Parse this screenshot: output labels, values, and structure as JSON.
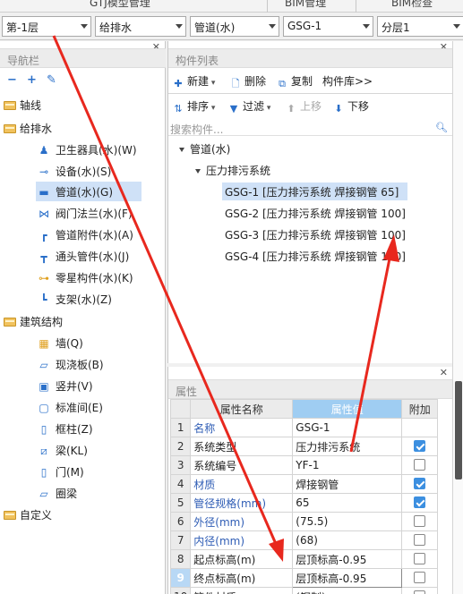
{
  "top_tabs": [
    "GTJ模型管理",
    "BIM管理",
    "BIM检查"
  ],
  "combos": [
    "第-1层",
    "给排水",
    "管道(水)",
    "GSG-1",
    "分层1"
  ],
  "nav": {
    "title": "导航栏",
    "tools": [
      "−",
      "+",
      "✎"
    ],
    "items": [
      {
        "label": "轴线",
        "icon": "folder-icon"
      },
      {
        "label": "给排水",
        "icon": "folder-icon"
      },
      {
        "label": "卫生器具(水)(W)",
        "icon": "sanitary-icon"
      },
      {
        "label": "设备(水)(S)",
        "icon": "equipment-icon"
      },
      {
        "label": "管道(水)(G)",
        "icon": "pipe-icon"
      },
      {
        "label": "阀门法兰(水)(F)",
        "icon": "valve-icon"
      },
      {
        "label": "管道附件(水)(A)",
        "icon": "pipe-fitting-icon"
      },
      {
        "label": "通头管件(水)(J)",
        "icon": "tee-icon"
      },
      {
        "label": "零星构件(水)(K)",
        "icon": "misc-component-icon"
      },
      {
        "label": "支架(水)(Z)",
        "icon": "bracket-icon"
      },
      {
        "label": "建筑结构",
        "icon": "folder-icon"
      },
      {
        "label": "墙(Q)",
        "icon": "wall-icon"
      },
      {
        "label": "现浇板(B)",
        "icon": "slab-icon"
      },
      {
        "label": "竖井(V)",
        "icon": "shaft-icon"
      },
      {
        "label": "标准间(E)",
        "icon": "standard-room-icon"
      },
      {
        "label": "框柱(Z)",
        "icon": "column-icon"
      },
      {
        "label": "梁(KL)",
        "icon": "beam-icon"
      },
      {
        "label": "门(M)",
        "icon": "door-icon"
      },
      {
        "label": "圈梁",
        "icon": "ring-beam-icon"
      },
      {
        "label": "自定义",
        "icon": "folder-icon"
      }
    ]
  },
  "component_list": {
    "title": "构件列表",
    "toolbar1": {
      "new": "新建",
      "delete": "删除",
      "copy": "复制",
      "library": "构件库>>"
    },
    "toolbar2": {
      "sort": "排序",
      "filter": "过滤",
      "up": "上移",
      "down": "下移"
    },
    "search_placeholder": "搜索构件...",
    "tree": {
      "root": "管道(水)",
      "group": "压力排污系统",
      "items": [
        "GSG-1 [压力排污系统 焊接钢管 65]",
        "GSG-2 [压力排污系统 焊接钢管 100]",
        "GSG-3 [压力排污系统 焊接钢管 100]",
        "GSG-4 [压力排污系统 焊接钢管 100]"
      ]
    }
  },
  "properties": {
    "title": "属性",
    "headers": [
      "属性名称",
      "属性值",
      "附加"
    ],
    "rows": [
      {
        "no": "1",
        "name": "名称",
        "value": "GSG-1",
        "checkbox": null,
        "blue": true
      },
      {
        "no": "2",
        "name": "系统类型",
        "value": "压力排污系统",
        "checkbox": true,
        "blue": false
      },
      {
        "no": "3",
        "name": "系统编号",
        "value": "YF-1",
        "checkbox": false,
        "blue": false
      },
      {
        "no": "4",
        "name": "材质",
        "value": "焊接钢管",
        "checkbox": true,
        "blue": true
      },
      {
        "no": "5",
        "name": "管径规格(mm)",
        "value": "65",
        "checkbox": true,
        "blue": true
      },
      {
        "no": "6",
        "name": "外径(mm)",
        "value": "(75.5)",
        "checkbox": false,
        "blue": true
      },
      {
        "no": "7",
        "name": "内径(mm)",
        "value": "(68)",
        "checkbox": false,
        "blue": true
      },
      {
        "no": "8",
        "name": "起点标高(m)",
        "value": "层顶标高-0.95",
        "checkbox": false,
        "blue": false
      },
      {
        "no": "9",
        "name": "终点标高(m)",
        "value": "层顶标高-0.95",
        "checkbox": false,
        "blue": false
      },
      {
        "no": "10",
        "name": "管件材质",
        "value": "(钢制)",
        "checkbox": false,
        "blue": false
      }
    ]
  },
  "colors": {
    "annotation_arrow": "#e8281e",
    "selection": "#cfe1f7",
    "accent": "#2a6fc9"
  }
}
